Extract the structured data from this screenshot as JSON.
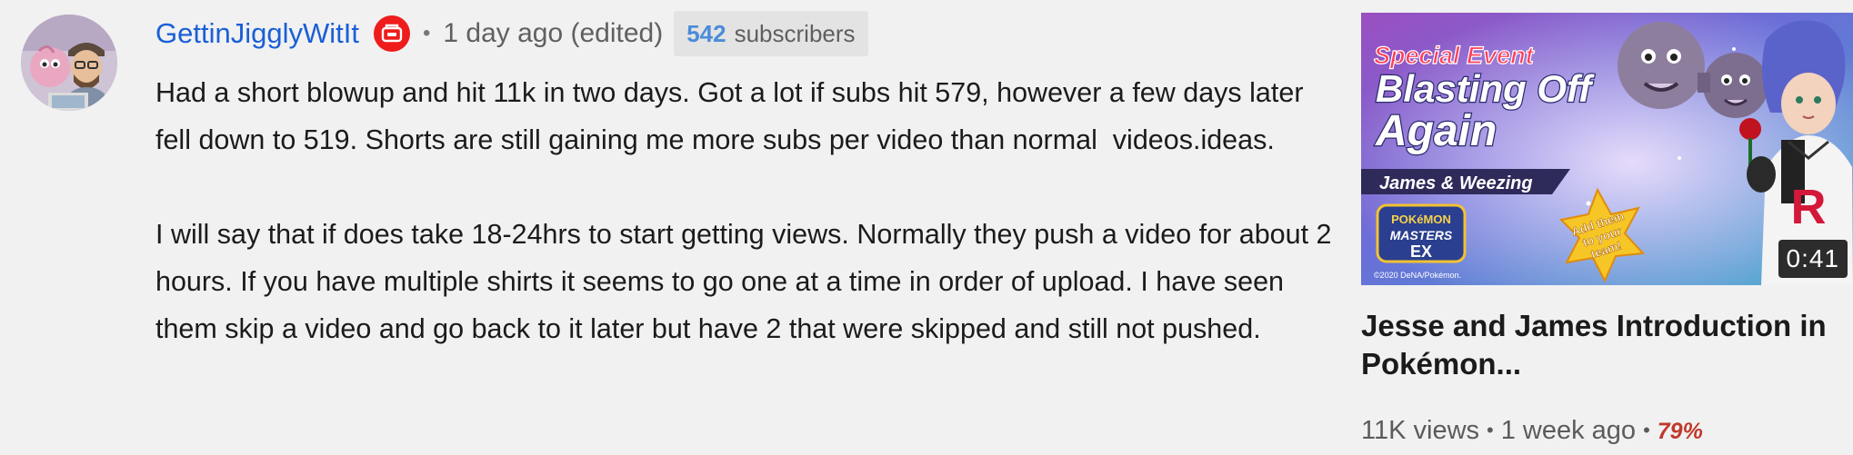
{
  "comment": {
    "author": "GettinJigglyWitIt",
    "badge_icon": "youtube-icon",
    "separator": "•",
    "time": "1 day ago (edited)",
    "subscriber_count": "542",
    "subscriber_label": "subscribers",
    "paragraphs": [
      "Had a short blowup and hit 11k in two days. Got a lot if subs hit 579, however a few days later fell down to 519. Shorts are still gaining me more subs per video than normal  videos.ideas.",
      "I will say that if does take 18-24hrs to start getting views. Normally they push a video for about 2 hours. If you have multiple shirts it seems to go one at a time in order of upload. I have seen them skip a video and go back to it later but have 2 that were skipped and still not pushed."
    ]
  },
  "video": {
    "thumbnail": {
      "line1": "Special Event",
      "line2": "Blasting Off",
      "line3": "Again",
      "subtitle": "James & Weezing",
      "logo_line1": "POKéMON",
      "logo_line2": "MASTERS",
      "logo_line3": "EX",
      "star_line1": "Add them",
      "star_line2": "to your",
      "star_line3": "team!",
      "copyright": "©2020 DeNA/Pokémon.",
      "r_letter": "R"
    },
    "duration": "0:41",
    "title": "Jesse and James Introduction in Pokémon...",
    "views": "11K views",
    "separator": "•",
    "age": "1 week ago",
    "rating": "79%"
  },
  "colors": {
    "author_link": "#1a5fd6",
    "badge_red": "#ee1c1c",
    "subs_count_blue": "#4a8cd9",
    "rating_red": "#c0392b",
    "background": "#f1f1f1"
  }
}
